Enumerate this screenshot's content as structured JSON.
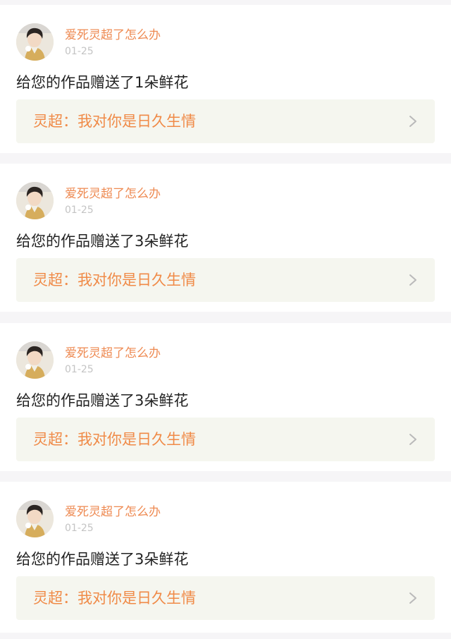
{
  "notifications": [
    {
      "username": "爱死灵超了怎么办",
      "date": "01-25",
      "message": "给您的作品赠送了1朵鲜花",
      "link_text": "灵超：我对你是日久生情"
    },
    {
      "username": "爱死灵超了怎么办",
      "date": "01-25",
      "message": "给您的作品赠送了3朵鲜花",
      "link_text": "灵超：我对你是日久生情"
    },
    {
      "username": "爱死灵超了怎么办",
      "date": "01-25",
      "message": "给您的作品赠送了3朵鲜花",
      "link_text": "灵超：我对你是日久生情"
    },
    {
      "username": "爱死灵超了怎么办",
      "date": "01-25",
      "message": "给您的作品赠送了3朵鲜花",
      "link_text": "灵超：我对你是日久生情"
    }
  ],
  "colors": {
    "username": "#ee8a52",
    "link_text": "#f08a47",
    "date": "#c4c4c4",
    "message": "#222222",
    "link_box_bg": "#f5f6ef",
    "page_bg": "#f6f5f7"
  },
  "icons": {
    "avatar": "user-avatar",
    "link_arrow": "chevron-right-icon"
  }
}
